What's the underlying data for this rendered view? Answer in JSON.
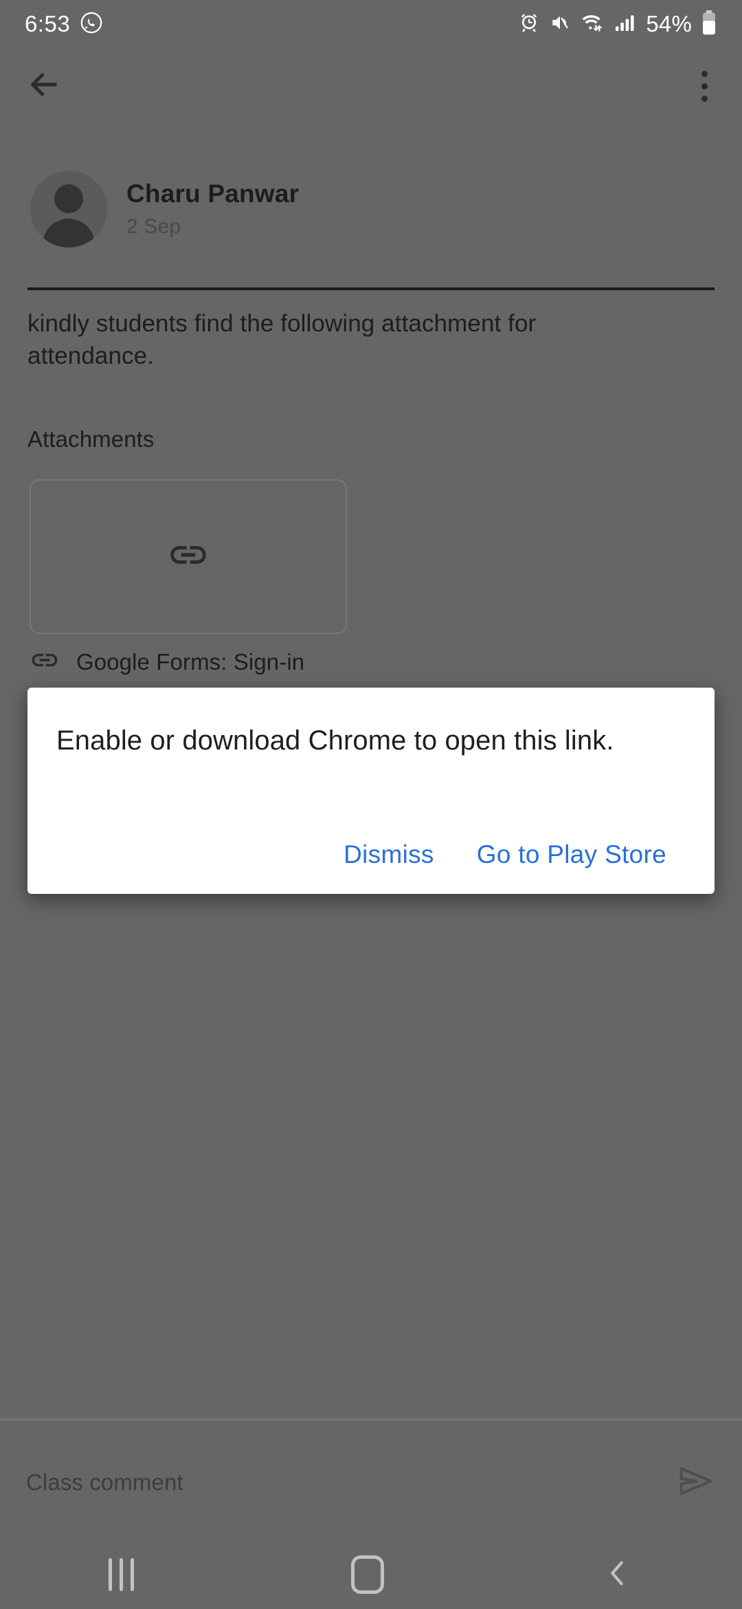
{
  "statusbar": {
    "time": "6:53",
    "battery_percent": "54%",
    "icons": [
      "whatsapp-icon",
      "alarm-icon",
      "mute-icon",
      "wifi-icon",
      "signal-icon",
      "battery-icon"
    ]
  },
  "toolbar": {
    "back_icon": "back-arrow-icon",
    "overflow_icon": "more-vert-icon"
  },
  "post": {
    "author_name": "Charu Panwar",
    "date": "2 Sep",
    "body": "kindly students find the following attachment for attendance.",
    "attachments_heading": "Attachments",
    "attachment": {
      "preview_icon": "link-icon",
      "title": "Google Forms: Sign-in"
    }
  },
  "comment": {
    "placeholder": "Class comment",
    "send_icon": "send-icon"
  },
  "navbar": {
    "recents_label": "recents-icon",
    "home_label": "home-icon",
    "back_label": "back-icon"
  },
  "dialog": {
    "message": "Enable or download Chrome to open this link.",
    "dismiss_label": "Dismiss",
    "playstore_label": "Go to Play Store",
    "link_color": "#2a6fd6"
  },
  "colors": {
    "scrim": "#666666",
    "dialog_bg": "#ffffff",
    "accent": "#2a6fd6"
  }
}
